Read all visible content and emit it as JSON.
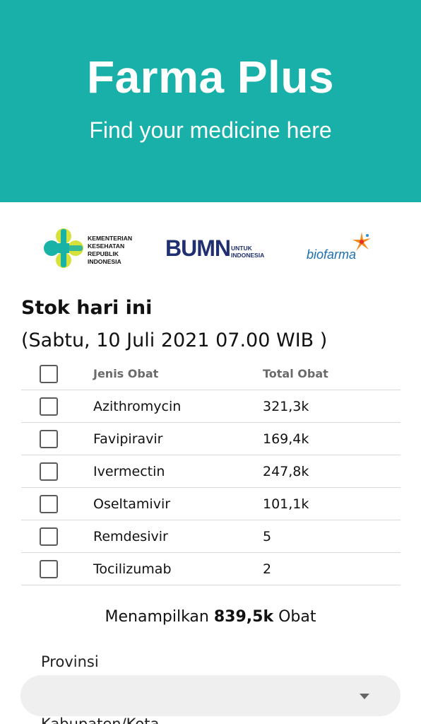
{
  "header": {
    "title": "Farma Plus",
    "subtitle": "Find your medicine here",
    "background_color": "#18b0a9"
  },
  "logos": {
    "kemenkes_text": "KEMENTERIAN KESEHATAN REPUBLIK INDONESIA",
    "kemenkes_lines": [
      "KEMENTERIAN",
      "KESEHATAN",
      "REPUBLIK",
      "INDONESIA"
    ],
    "bumn_mark": "BUMN",
    "bumn_tagline_lines": [
      "UNTUK",
      "INDONESIA"
    ],
    "biofarma_name": "biofarma"
  },
  "stock": {
    "title": "Stok hari ini",
    "date": "(Sabtu, 10 Juli 2021 07.00 WIB )"
  },
  "table": {
    "columns": [
      "Jenis Obat",
      "Total Obat"
    ],
    "rows": [
      {
        "name": "Azithromycin",
        "total": "321,3k"
      },
      {
        "name": "Favipiravir",
        "total": "169,4k"
      },
      {
        "name": "Ivermectin",
        "total": "247,8k"
      },
      {
        "name": "Oseltamivir",
        "total": "101,1k"
      },
      {
        "name": "Remdesivir",
        "total": "5"
      },
      {
        "name": "Tocilizumab",
        "total": "2"
      }
    ]
  },
  "summary": {
    "prefix": "Menampilkan",
    "count": "839,5k",
    "suffix": "Obat"
  },
  "filters": {
    "province_label": "Provinsi",
    "province_value": "",
    "regency_label": "Kabupaten/Kota"
  }
}
